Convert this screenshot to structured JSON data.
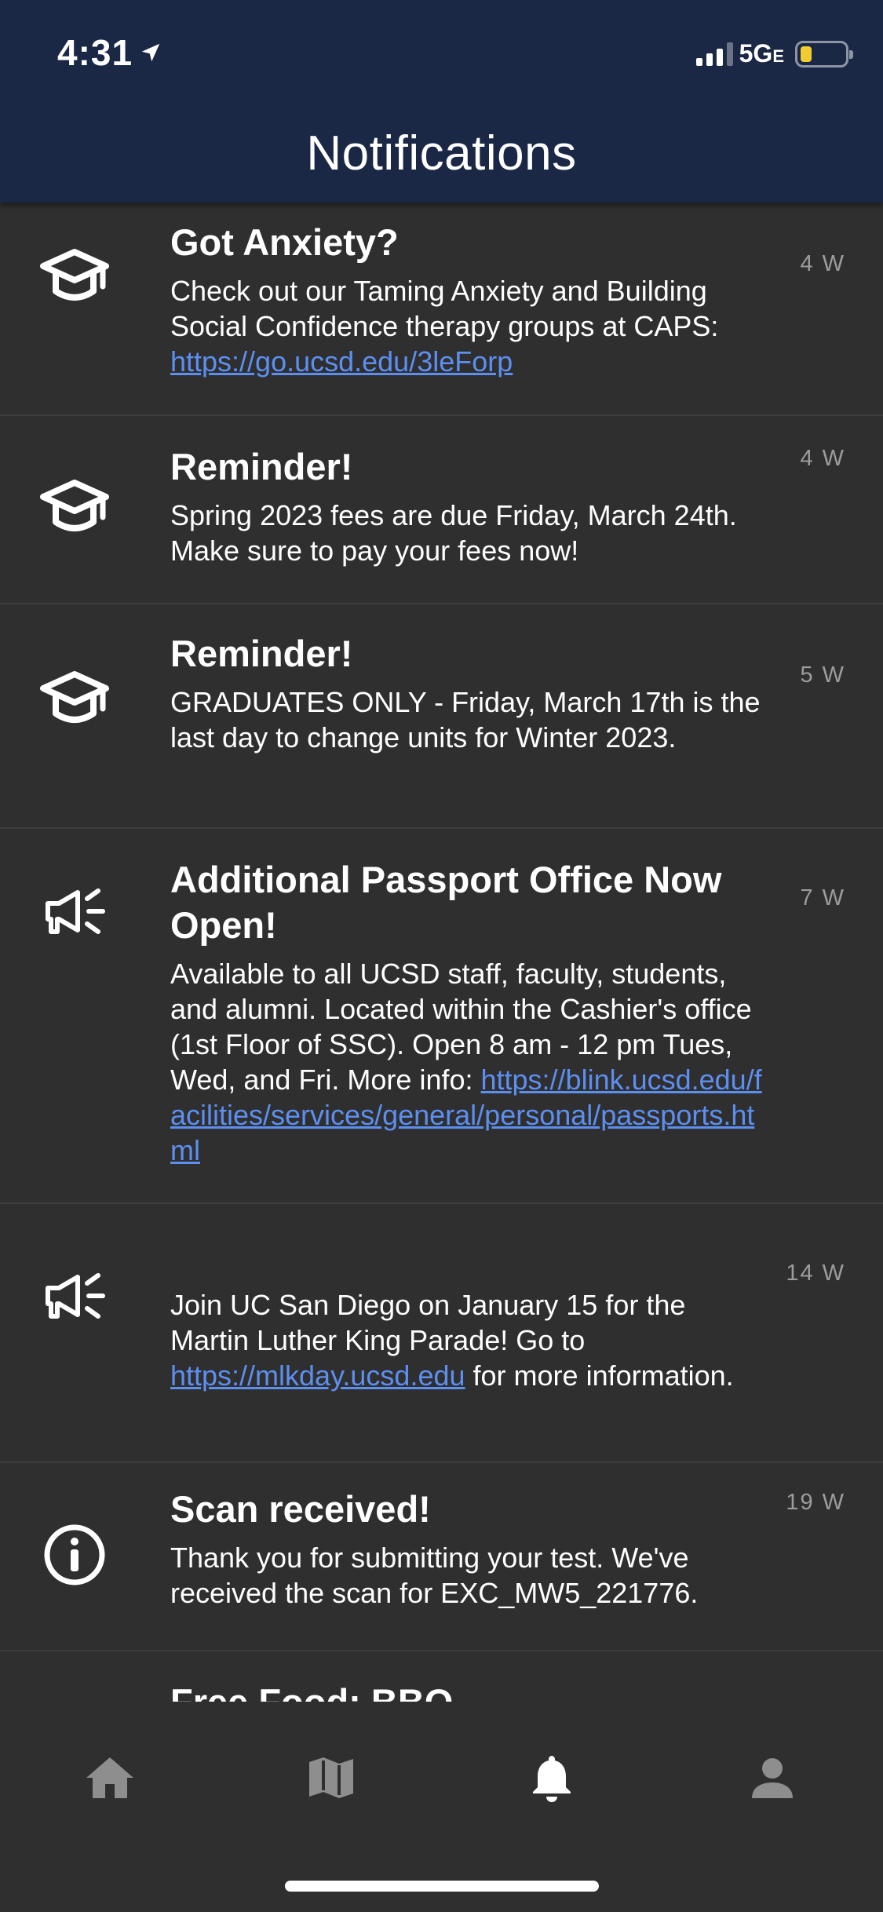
{
  "status_bar": {
    "time": "4:31",
    "network": "5G",
    "network_suffix": "E"
  },
  "header": {
    "title": "Notifications"
  },
  "notifications": [
    {
      "icon": "graduation-cap-icon",
      "title": "Got Anxiety?",
      "body_text": "Check out our Taming Anxiety and Building Social Confidence therapy groups at CAPS: ",
      "link": "https://go.ucsd.edu/3leForp",
      "age": "4 W"
    },
    {
      "icon": "graduation-cap-icon",
      "title": "Reminder!",
      "body_text": "Spring 2023 fees are due Friday, March 24th.  Make sure to pay your fees now!",
      "age": "4 W"
    },
    {
      "icon": "graduation-cap-icon",
      "title": "Reminder!",
      "body_text": "GRADUATES ONLY - Friday, March 17th is the last day to change units for Winter 2023.",
      "age": "5 W"
    },
    {
      "icon": "megaphone-icon",
      "title": "Additional Passport Office Now Open!",
      "body_text": "Available to all UCSD staff, faculty, students, and alumni. Located within the Cashier's office (1st Floor of SSC). Open 8 am - 12 pm Tues, Wed, and Fri. More info: ",
      "link": "https://blink.ucsd.edu/facilities/services/general/personal/passports.html",
      "age": "7 W"
    },
    {
      "icon": "megaphone-icon",
      "title": "",
      "body_text": "Join UC San Diego on January 15 for the Martin Luther King Parade! Go to ",
      "link": "https://mlkday.ucsd.edu",
      "body_after": " for more information.",
      "age": "14 W"
    },
    {
      "icon": "info-icon",
      "title": "Scan received!",
      "body_text": "Thank you for submitting your test. We've received the scan for EXC_MW5_221776.",
      "age": "19 W"
    },
    {
      "title": "Free Food: BBQ"
    }
  ],
  "tabbar": {
    "tabs": [
      {
        "icon": "home-icon",
        "active": false
      },
      {
        "icon": "map-icon",
        "active": false
      },
      {
        "icon": "bell-icon",
        "active": true
      },
      {
        "icon": "person-icon",
        "active": false
      }
    ]
  },
  "colors": {
    "header_bg": "#1b2845",
    "list_bg": "#2f2f2f",
    "link": "#5d8ff0",
    "age_text": "#9c9c9c",
    "battery": "#f2cc2f"
  }
}
